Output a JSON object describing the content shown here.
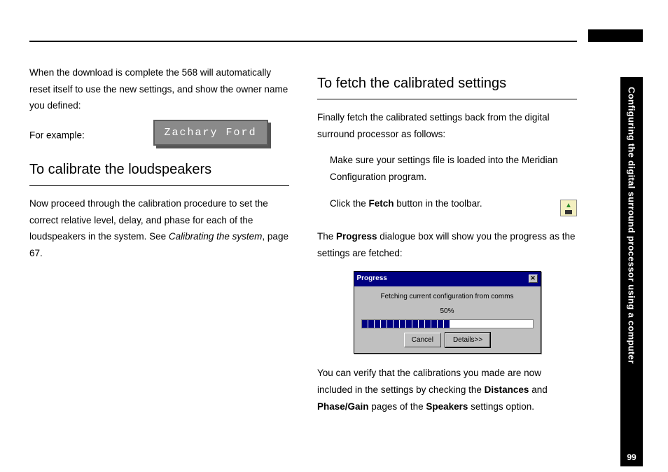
{
  "side": {
    "chapter_title": "Configuring the digital surround processor using a computer",
    "page_number": "99"
  },
  "left": {
    "intro": "When the download is complete the 568 will automatically reset itself to use the new settings, and show the owner name you defined:",
    "example_prefix": "For example:",
    "owner_name": "Zachary Ford",
    "h_calibrate": "To calibrate the loudspeakers",
    "calibrate_p_pre": "Now proceed through the calibration procedure to set the correct relative level, delay, and phase for each of the loudspeakers in the system. See ",
    "calibrate_p_em": "Calibrating the system",
    "calibrate_p_post": ", page 67."
  },
  "right": {
    "h_fetch": "To fetch the calibrated settings",
    "fetch_intro": "Finally fetch the calibrated settings back from the digital surround processor as follows:",
    "step1": "Make sure your settings file is loaded into the Meridian Configuration program.",
    "step2_pre": "Click the ",
    "step2_b": "Fetch",
    "step2_post": " button in the toolbar.",
    "progress_sentence_pre": "The ",
    "progress_sentence_b": "Progress",
    "progress_sentence_post": " dialogue box will show you the progress as the settings are fetched:",
    "dialog": {
      "title": "Progress",
      "message": "Fetching current configuration from comms",
      "percent": "50%",
      "btn_cancel": "Cancel",
      "btn_details": "Details>>"
    },
    "verify_pre": "You can verify that the calibrations you made are now included in the settings by checking the ",
    "verify_b1": "Distances",
    "verify_mid1": " and ",
    "verify_b2": "Phase/Gain",
    "verify_mid2": " pages of the ",
    "verify_b3": "Speakers",
    "verify_post": " settings option."
  }
}
